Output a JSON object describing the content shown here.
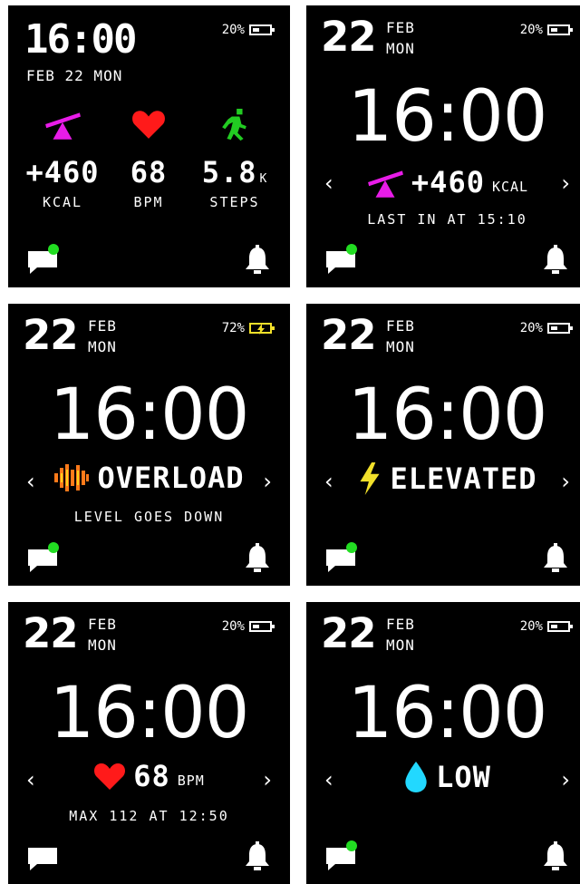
{
  "colors": {
    "background": "#000000",
    "text": "#ffffff",
    "magenta": "#e81ce8",
    "red": "#ff1a1a",
    "green": "#22cc22",
    "yellow": "#f2e02a",
    "orange": "#ff7a1a",
    "cyan": "#22d8ff",
    "notif": "#22dd22"
  },
  "screen1": {
    "time": "16:00",
    "date": "FEB 22 MON",
    "battery": "20%",
    "battery_level": 0.2,
    "stats": [
      {
        "icon": "seesaw-icon",
        "value": "+460",
        "suffix": "",
        "label": "KCAL"
      },
      {
        "icon": "heart-icon",
        "value": "68",
        "suffix": "",
        "label": "BPM"
      },
      {
        "icon": "running-person-icon",
        "value": "5.8",
        "suffix": "K",
        "label": "STEPS"
      }
    ],
    "chat_notification": true
  },
  "screen2": {
    "day": "22",
    "month": "FEB",
    "weekday": "MON",
    "battery": "20%",
    "battery_level": 0.2,
    "time": "16:00",
    "metric_icon": "seesaw-icon",
    "metric_value": "+460",
    "metric_unit": "KCAL",
    "subline": "LAST IN AT 15:10",
    "chat_notification": true
  },
  "screen3": {
    "day": "22",
    "month": "FEB",
    "weekday": "MON",
    "battery": "72%",
    "battery_charging": true,
    "time": "16:00",
    "metric_icon": "stress-bars-icon",
    "metric_value": "OVERLOAD",
    "subline": "LEVEL GOES DOWN",
    "chat_notification": true
  },
  "screen4": {
    "day": "22",
    "month": "FEB",
    "weekday": "MON",
    "battery": "20%",
    "battery_level": 0.2,
    "time": "16:00",
    "metric_icon": "lightning-icon",
    "metric_value": "ELEVATED",
    "chat_notification": true
  },
  "screen5": {
    "day": "22",
    "month": "FEB",
    "weekday": "MON",
    "battery": "20%",
    "battery_level": 0.2,
    "time": "16:00",
    "metric_icon": "heart-icon",
    "metric_value": "68",
    "metric_unit": "BPM",
    "subline": "MAX 112 AT 12:50",
    "chat_notification": false
  },
  "screen6": {
    "day": "22",
    "month": "FEB",
    "weekday": "MON",
    "battery": "20%",
    "battery_level": 0.2,
    "time": "16:00",
    "metric_icon": "water-drop-icon",
    "metric_value": "LOW",
    "chat_notification": true
  },
  "nav": {
    "prev": "‹",
    "next": "›"
  }
}
